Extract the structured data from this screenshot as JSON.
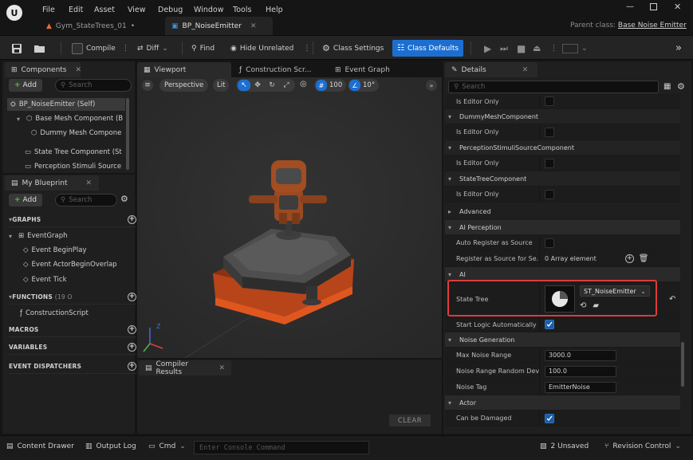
{
  "menu": [
    "File",
    "Edit",
    "Asset",
    "View",
    "Debug",
    "Window",
    "Tools",
    "Help"
  ],
  "tabs": [
    {
      "label": "Gym_StateTrees_01",
      "modified": "•"
    },
    {
      "label": "BP_NoiseEmitter"
    }
  ],
  "parent_class": {
    "label": "Parent class:",
    "value": "Base Noise Emitter"
  },
  "toolbar": {
    "compile": "Compile",
    "diff": "Diff",
    "find": "Find",
    "hide_unrelated": "Hide Unrelated",
    "class_settings": "Class Settings",
    "class_defaults": "Class Defaults"
  },
  "components_panel": {
    "title": "Components",
    "add": "Add",
    "search_placeholder": "Search",
    "items": [
      "BP_NoiseEmitter (Self)",
      "Base Mesh Component (B",
      "Dummy Mesh Compone",
      "State Tree Component (St",
      "Perception Stimuli Source"
    ]
  },
  "blueprint_panel": {
    "title": "My Blueprint",
    "add": "Add",
    "search_placeholder": "Search",
    "graphs_header": "GRAPHS",
    "graph_name": "EventGraph",
    "events": [
      "Event BeginPlay",
      "Event ActorBeginOverlap",
      "Event Tick"
    ],
    "functions_header": "FUNCTIONS",
    "functions_count": "(19 O",
    "function_item": "ConstructionScript",
    "macros_header": "MACROS",
    "variables_header": "VARIABLES",
    "dispatchers_header": "EVENT DISPATCHERS"
  },
  "editor_tabs": [
    "Viewport",
    "Construction Scr...",
    "Event Graph"
  ],
  "viewport": {
    "perspective": "Perspective",
    "lit": "Lit",
    "grid_value": "100",
    "angle_value": "10°",
    "axis_label": "Z"
  },
  "compiler": {
    "title": "Compiler Results",
    "clear": "CLEAR"
  },
  "details": {
    "title": "Details",
    "search_placeholder": "Search",
    "rows": {
      "is_editor_only": "Is Editor Only",
      "dummy_mesh": "DummyMeshComponent",
      "perception": "PerceptionStimuliSourceComponent",
      "state_tree_comp": "StateTreeComponent",
      "advanced": "Advanced",
      "ai_perception": "AI Perception",
      "auto_register": "Auto Register as Source",
      "register_senses": "Register as Source for Se...",
      "array_elements": "0 Array element",
      "ai": "AI",
      "state_tree": "State Tree",
      "state_tree_asset": "ST_NoiseEmitter",
      "start_logic": "Start Logic Automatically",
      "noise_generation": "Noise Generation",
      "max_noise_range": "Max Noise Range",
      "max_noise_value": "3000.0",
      "noise_random": "Noise Range Random Dev...",
      "noise_random_value": "100.0",
      "noise_tag": "Noise Tag",
      "noise_tag_value": "EmitterNoise",
      "actor": "Actor",
      "can_be_damaged": "Can be Damaged"
    }
  },
  "statusbar": {
    "content_drawer": "Content Drawer",
    "output_log": "Output Log",
    "cmd": "Cmd",
    "console_placeholder": "Enter Console Command",
    "unsaved": "2 Unsaved",
    "revision": "Revision Control"
  },
  "colors": {
    "accent": "#1c6fd1",
    "highlight": "#e03b3b",
    "bg": "#151515",
    "panel": "#1f1f1f"
  }
}
